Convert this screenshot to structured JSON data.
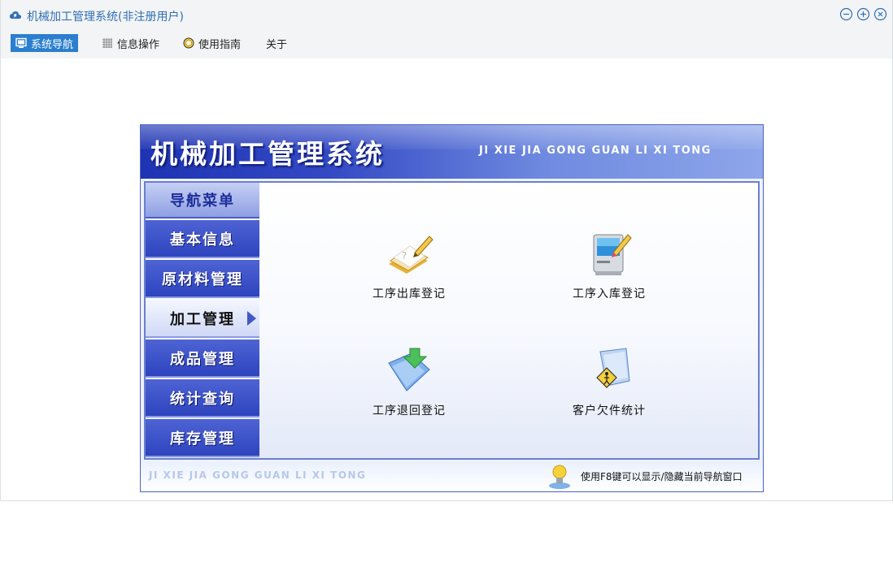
{
  "window": {
    "title": "机械加工管理系统(非注册用户)",
    "icon": "cloud-app-icon",
    "controls": [
      "minimize-icon",
      "maximize-icon",
      "close-icon"
    ]
  },
  "menubar": {
    "items": [
      {
        "label": "系统导航",
        "icon": "monitor-icon",
        "active": true
      },
      {
        "label": "信息操作",
        "icon": "grid-icon",
        "active": false
      },
      {
        "label": "使用指南",
        "icon": "compass-icon",
        "active": false
      },
      {
        "label": "关于",
        "icon": "",
        "active": false
      }
    ]
  },
  "nav": {
    "title": "机械加工管理系统",
    "subtitle": "JI XIE JIA GONG GUAN LI XI TONG",
    "menu_header": "导航菜单",
    "menu": [
      {
        "label": "基本信息",
        "active": false
      },
      {
        "label": "原材料管理",
        "active": false
      },
      {
        "label": "加工管理",
        "active": true
      },
      {
        "label": "成品管理",
        "active": false
      },
      {
        "label": "统计查询",
        "active": false
      },
      {
        "label": "库存管理",
        "active": false
      }
    ],
    "tiles": [
      {
        "label": "工序出库登记",
        "icon": "notebook-pencil-icon"
      },
      {
        "label": "工序入库登记",
        "icon": "computer-pencil-icon"
      },
      {
        "label": "工序退回登记",
        "icon": "folder-download-icon"
      },
      {
        "label": "客户欠件统计",
        "icon": "folder-sign-icon"
      }
    ],
    "footer_text": "JI XIE JIA GONG GUAN LI XI TONG",
    "hint": "使用F8键可以显示/隐藏当前导航窗口"
  },
  "colors": {
    "accent": "#2b7fcf",
    "title_text": "#2f6fb7",
    "nav_blue": "#2e44bf"
  }
}
